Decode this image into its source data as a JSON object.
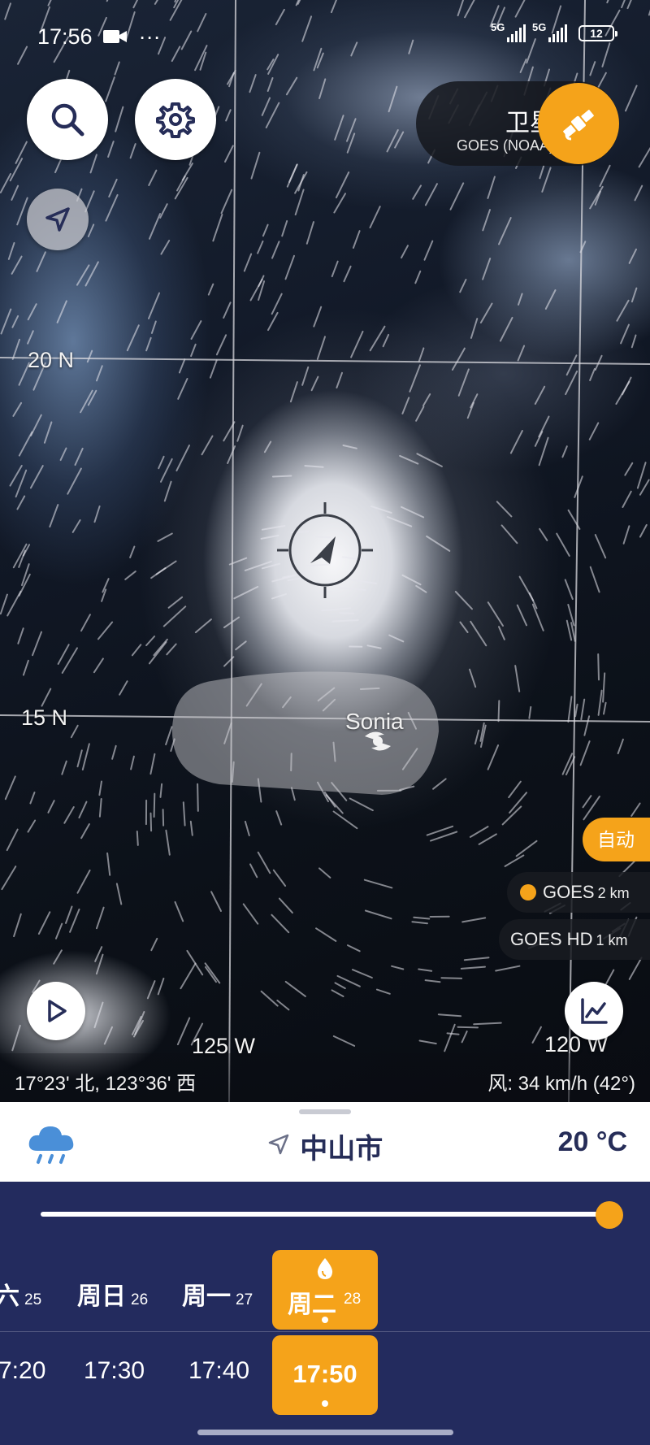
{
  "status_bar": {
    "time": "17:56",
    "extra": "···",
    "network1": "5G",
    "network2": "5G",
    "battery": "12"
  },
  "layer": {
    "title": "卫星",
    "subtitle": "GOES (NOAA)"
  },
  "grid": {
    "lat_20": "20 N",
    "lat_15": "15 N",
    "lon_125": "125 W",
    "lon_120": "120 W"
  },
  "storm": {
    "name": "Sonia"
  },
  "sources": {
    "auto_label": "自动",
    "goes_label": "GOES",
    "goes_res": "2 km",
    "goes_hd_label": "GOES HD",
    "goes_hd_res": "1 km"
  },
  "map_footer": {
    "coordinates": "17°23' 北, 123°36' 西",
    "wind": "风: 34 km/h (42°)"
  },
  "location": {
    "city": "中山市",
    "temperature": "20 °C"
  },
  "timeline": {
    "progress": 1.0,
    "days": [
      {
        "name": "六",
        "num": "25"
      },
      {
        "name": "周日",
        "num": "26"
      },
      {
        "name": "周一",
        "num": "27"
      },
      {
        "name": "周二",
        "num": "28"
      }
    ],
    "times": [
      "7:20",
      "17:30",
      "17:40",
      "17:50"
    ]
  },
  "colors": {
    "accent": "#f5a31a",
    "timeline_bg": "#232b5e",
    "city_text": "#262d58"
  }
}
